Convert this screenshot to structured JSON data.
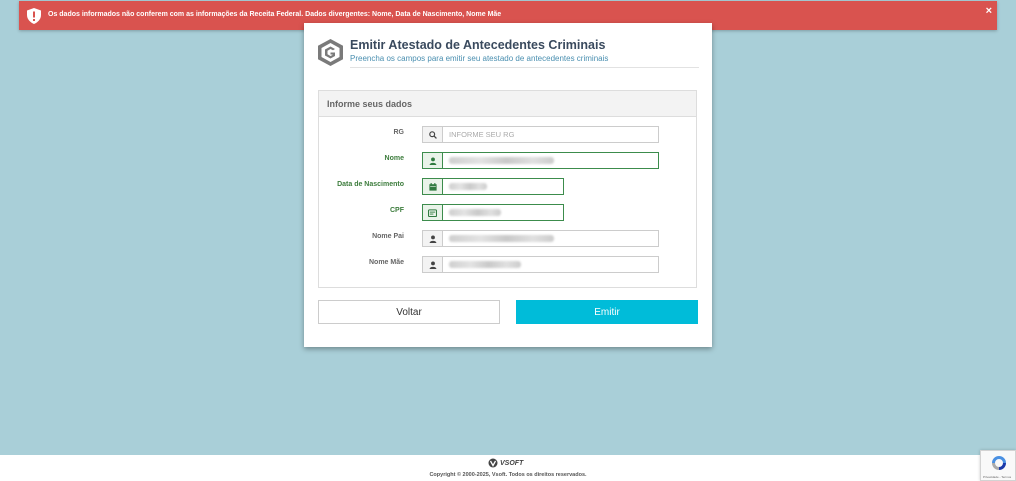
{
  "alert": {
    "message": "Os dados informados não conferem com as informações da Receita Federal. Dados divergentes: Nome, Data de Nascimento, Nome Mãe",
    "close_label": "×",
    "color": "#d9534f"
  },
  "header": {
    "title": "Emitir Atestado de Antecedentes Criminais",
    "subtitle": "Preencha os campos para emitir seu atestado de antecedentes criminais"
  },
  "form": {
    "panel_title": "Informe seus dados",
    "fields": [
      {
        "label": "RG",
        "placeholder": "INFORME SEU RG",
        "icon": "search-icon",
        "state": "default"
      },
      {
        "label": "Nome",
        "icon": "user-icon",
        "state": "valid"
      },
      {
        "label": "Data de Nascimento",
        "icon": "calendar-icon",
        "state": "valid"
      },
      {
        "label": "CPF",
        "icon": "id-card-icon",
        "state": "valid"
      },
      {
        "label": "Nome Pai",
        "icon": "user-icon",
        "state": "default"
      },
      {
        "label": "Nome Mãe",
        "icon": "user-icon",
        "state": "default"
      }
    ]
  },
  "buttons": {
    "back_label": "Voltar",
    "emit_label": "Emitir",
    "emit_color": "#00bcd9"
  },
  "footer": {
    "brand": "VSOFT",
    "copyright": "Copyright © 2000-2025, Vsoft. Todos os direitos reservados."
  },
  "recaptcha": {
    "links": "Privacidade - Termos"
  },
  "colors": {
    "background": "#a9cfd8",
    "valid": "#3c8c4c",
    "title": "#3a4a5e"
  }
}
